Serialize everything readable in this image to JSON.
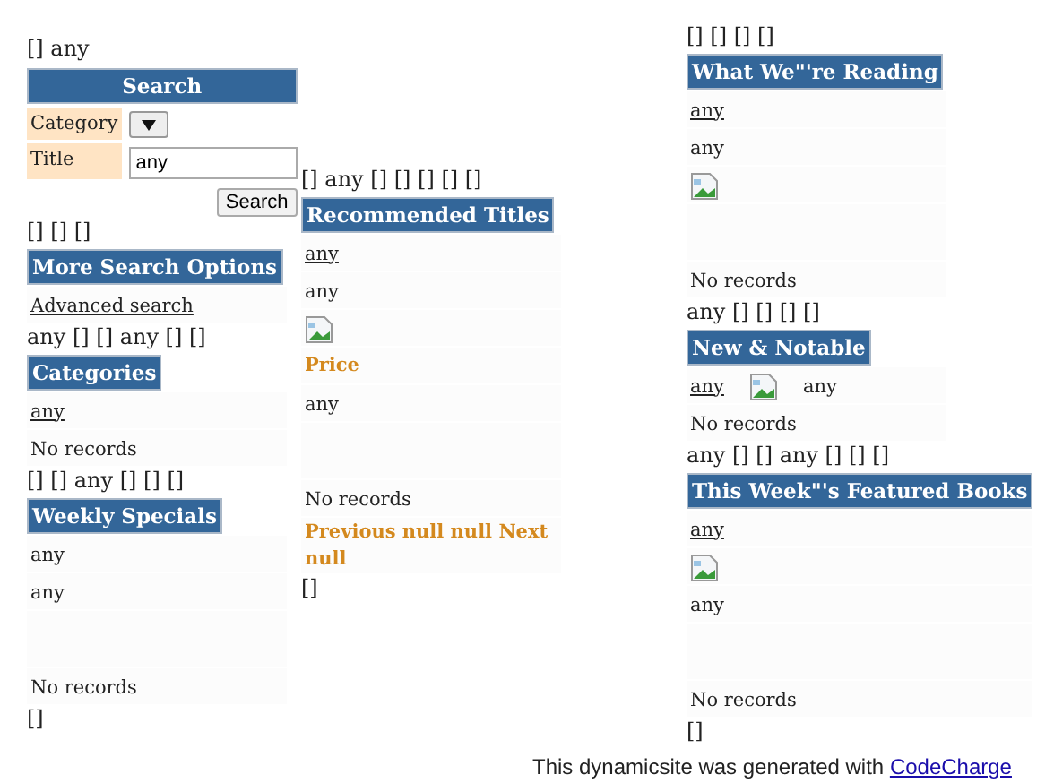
{
  "columns": [
    {
      "blocks": [
        {
          "kind": "line",
          "text": "[] any"
        },
        {
          "kind": "search",
          "title": "Search",
          "fields": [
            {
              "kind": "select",
              "label": "Category"
            },
            {
              "kind": "input",
              "label": "Title",
              "value": "any"
            }
          ],
          "button": "Search"
        },
        {
          "kind": "line",
          "text": "[] [] []"
        },
        {
          "kind": "panel",
          "title": "More Search Options",
          "rows": [
            {
              "kind": "link",
              "text": "Advanced search"
            }
          ]
        },
        {
          "kind": "line",
          "text": "any [] [] any [] []"
        },
        {
          "kind": "panel",
          "title": "Categories",
          "rows": [
            {
              "kind": "link",
              "text": "any"
            },
            {
              "kind": "text",
              "text": "No records"
            }
          ]
        },
        {
          "kind": "line",
          "text": "[] [] any [] [] []"
        },
        {
          "kind": "panel",
          "title": "Weekly Specials",
          "rows": [
            {
              "kind": "text",
              "text": "any"
            },
            {
              "kind": "text",
              "text": "any"
            },
            {
              "kind": "blank"
            },
            {
              "kind": "text",
              "text": "No records"
            }
          ]
        },
        {
          "kind": "line",
          "text": "[]"
        }
      ]
    },
    {
      "blocks": [
        {
          "kind": "line",
          "text": "[] any [] [] [] [] []"
        },
        {
          "kind": "panel",
          "title": "Recommended Titles",
          "rows": [
            {
              "kind": "link",
              "text": "any"
            },
            {
              "kind": "text",
              "text": "any"
            },
            {
              "kind": "image"
            },
            {
              "kind": "price",
              "text": "Price"
            },
            {
              "kind": "text",
              "text": "any"
            },
            {
              "kind": "blank"
            },
            {
              "kind": "text",
              "text": "No records"
            },
            {
              "kind": "price",
              "text": "Previous null null Next null"
            }
          ]
        },
        {
          "kind": "line",
          "text": "[]"
        }
      ]
    },
    {
      "blocks": [
        {
          "kind": "line",
          "text": "[] [] [] []"
        },
        {
          "kind": "panel",
          "title": "What We\"'re Reading",
          "rows": [
            {
              "kind": "link",
              "text": "any"
            },
            {
              "kind": "text",
              "text": "any"
            },
            {
              "kind": "image"
            },
            {
              "kind": "blank"
            },
            {
              "kind": "text",
              "text": "No records"
            }
          ]
        },
        {
          "kind": "line",
          "text": "any [] [] [] []"
        },
        {
          "kind": "panel",
          "title": "New & Notable",
          "rows": [
            {
              "kind": "group",
              "items": [
                {
                  "kind": "link",
                  "text": "any"
                },
                {
                  "kind": "image"
                },
                {
                  "kind": "text",
                  "text": "any"
                }
              ]
            },
            {
              "kind": "text",
              "text": "No records"
            }
          ]
        },
        {
          "kind": "line",
          "text": "any [] [] any [] [] []"
        },
        {
          "kind": "panel",
          "title": "This Week\"'s Featured Books",
          "rows": [
            {
              "kind": "link",
              "text": "any"
            },
            {
              "kind": "image"
            },
            {
              "kind": "text",
              "text": "any"
            },
            {
              "kind": "blank"
            },
            {
              "kind": "text",
              "text": "No records"
            }
          ]
        },
        {
          "kind": "line",
          "text": "[]"
        }
      ]
    }
  ],
  "footer": {
    "text": "This dynamicsite was generated with",
    "link": "CodeCharge"
  }
}
